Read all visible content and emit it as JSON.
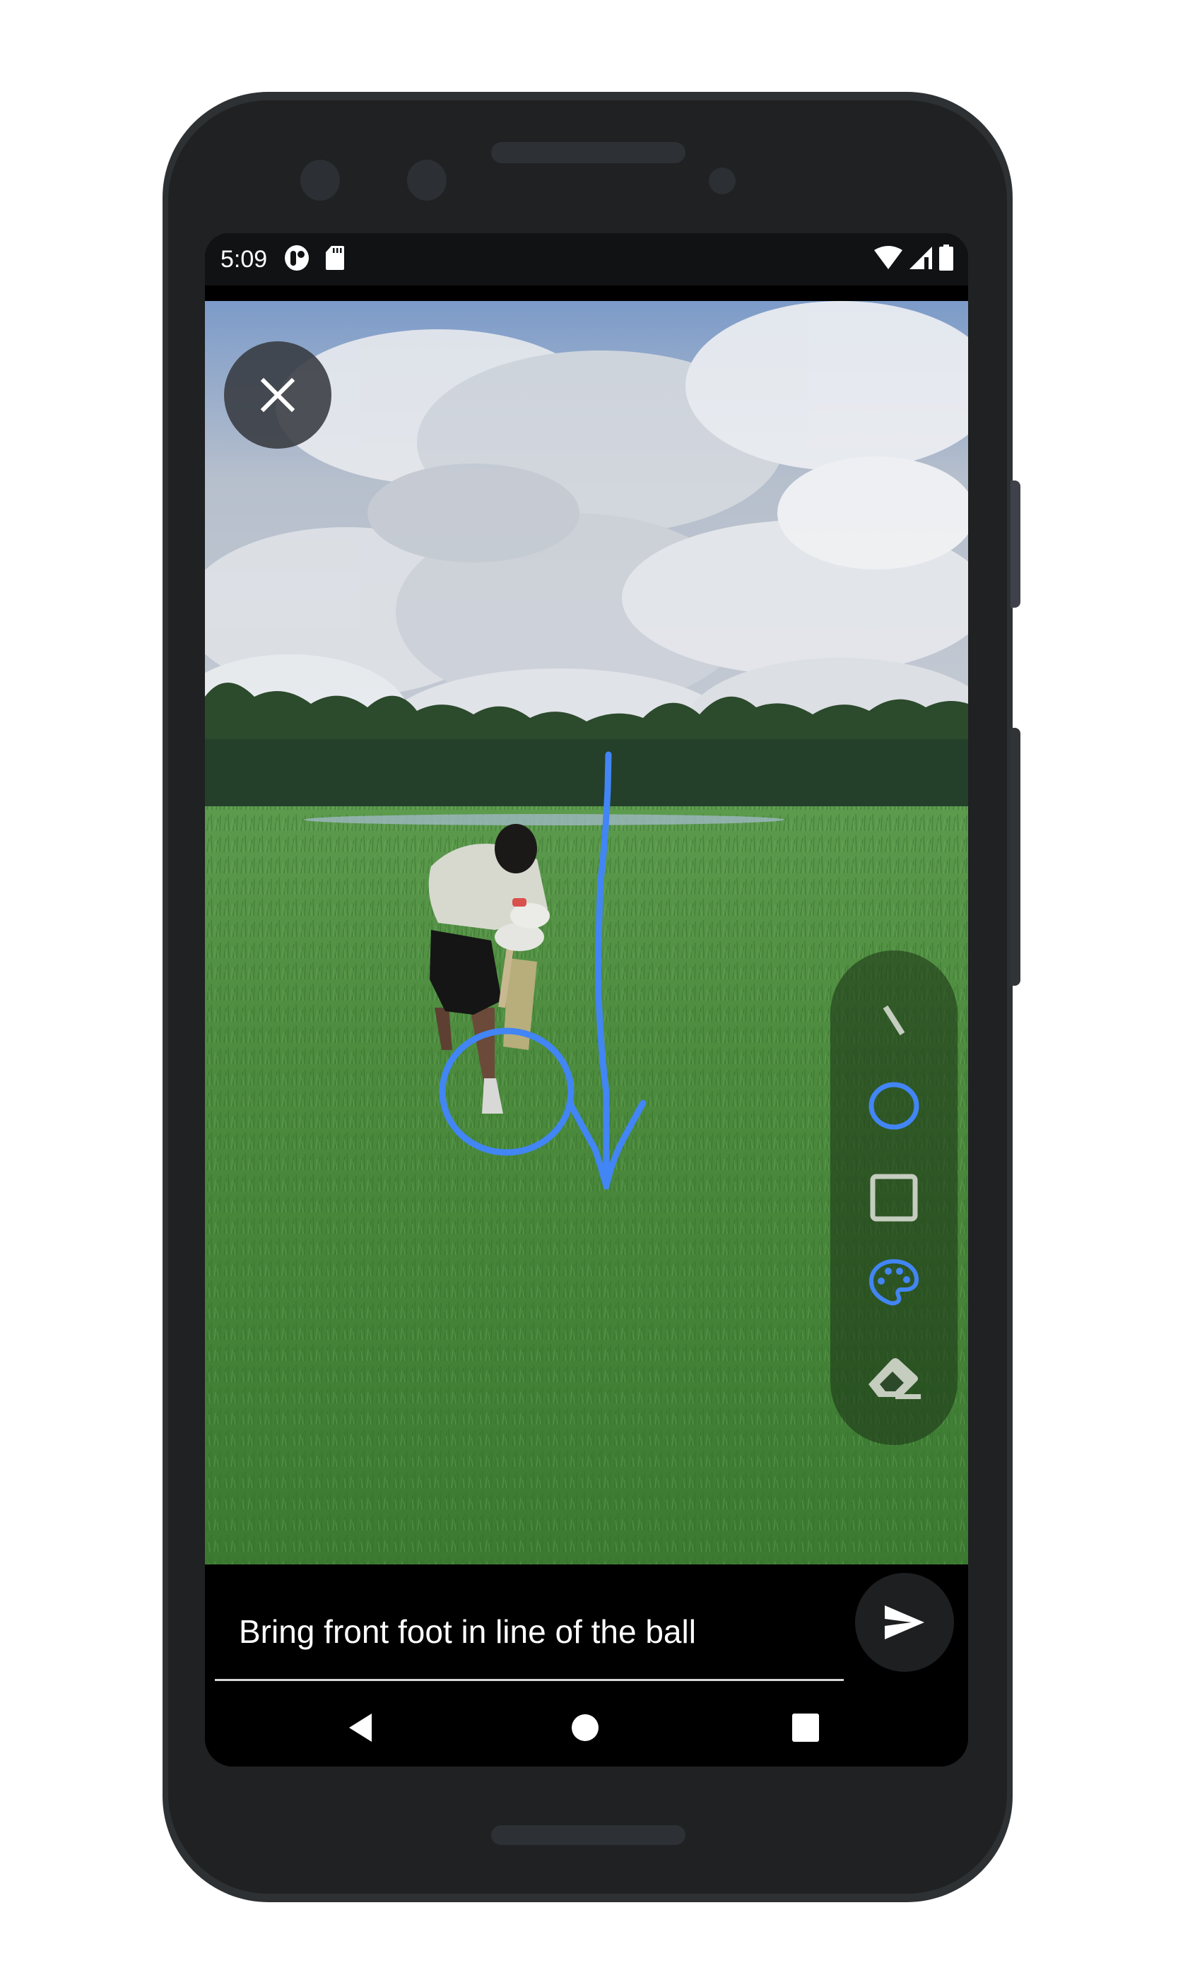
{
  "status_bar": {
    "time": "5:09",
    "left_icons": [
      "media-app-icon",
      "sd-card-icon"
    ],
    "right_icons": [
      "wifi-icon",
      "cellular-signal-icon",
      "battery-icon"
    ]
  },
  "video": {
    "description": "Cricket batsman playing a shot on a grass field under a cloudy sky",
    "close_button": {
      "icon": "close-icon",
      "label": "Close"
    }
  },
  "annotations": [
    {
      "type": "circle",
      "target": "front foot",
      "color": "#4285f4"
    },
    {
      "type": "arrow",
      "direction": "down",
      "color": "#4285f4"
    }
  ],
  "drawing_toolbar": {
    "accent_color": "#4285f4",
    "inactive_color": "#c5cdbf",
    "tools": [
      {
        "name": "line",
        "icon": "line-tool-icon",
        "selected": false
      },
      {
        "name": "circle",
        "icon": "circle-tool-icon",
        "selected": true
      },
      {
        "name": "rectangle",
        "icon": "rectangle-tool-icon",
        "selected": false
      },
      {
        "name": "color",
        "icon": "palette-icon",
        "selected": true
      },
      {
        "name": "eraser",
        "icon": "eraser-icon",
        "selected": false
      }
    ]
  },
  "comment": {
    "value": "Bring front foot in line of the ball",
    "send_icon": "send-icon"
  },
  "nav_bar": {
    "buttons": [
      "back",
      "home",
      "recents"
    ]
  }
}
